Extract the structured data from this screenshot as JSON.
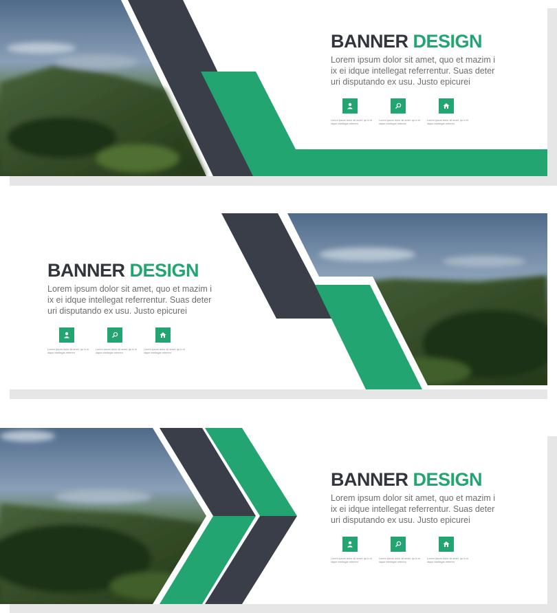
{
  "colors": {
    "green": "#22a571",
    "dark": "#393e48",
    "text": "#33353d",
    "body": "#6e6e6e"
  },
  "banners": [
    {
      "title_main": "BANNER ",
      "title_accent": "DESIGN",
      "description": "Lorem ipsum dolor sit amet, quo et mazim i ix ei idque intellegat referrentur. Suas deter uri disputando ex usu. Justo epicurei",
      "icons": [
        {
          "icon": "user-icon",
          "caption": "Lorem ipsum dolor sit amet, qu ix ei idque intellegat referren"
        },
        {
          "icon": "search-icon",
          "caption": "Lorem ipsum dolor sit amet, qu ix ei idque intellegat referren"
        },
        {
          "icon": "home-icon",
          "caption": "Lorem ipsum dolor sit amet, qu ix ei idque intellegat referren"
        }
      ]
    },
    {
      "title_main": "BANNER ",
      "title_accent": "DESIGN",
      "description": "Lorem ipsum dolor sit amet, quo et mazim i ix ei idque intellegat referrentur. Suas deter uri disputando ex usu. Justo epicurei",
      "icons": [
        {
          "icon": "user-icon",
          "caption": "Lorem ipsum dolor sit amet, qu ix ei idque intellegat referren"
        },
        {
          "icon": "search-icon",
          "caption": "Lorem ipsum dolor sit amet, qu ix ei idque intellegat referren"
        },
        {
          "icon": "home-icon",
          "caption": "Lorem ipsum dolor sit amet, qu ix ei idque intellegat referren"
        }
      ]
    },
    {
      "title_main": "BANNER ",
      "title_accent": "DESIGN",
      "description": "Lorem ipsum dolor sit amet, quo et mazim i ix ei idque intellegat referrentur. Suas deter uri disputando ex usu. Justo epicurei",
      "icons": [
        {
          "icon": "user-icon",
          "caption": "Lorem ipsum dolor sit amet, qu ix ei idque intellegat referren"
        },
        {
          "icon": "search-icon",
          "caption": "Lorem ipsum dolor sit amet, qu ix ei idque intellegat referren"
        },
        {
          "icon": "home-icon",
          "caption": "Lorem ipsum dolor sit amet, qu ix ei idque intellegat referren"
        }
      ]
    }
  ]
}
